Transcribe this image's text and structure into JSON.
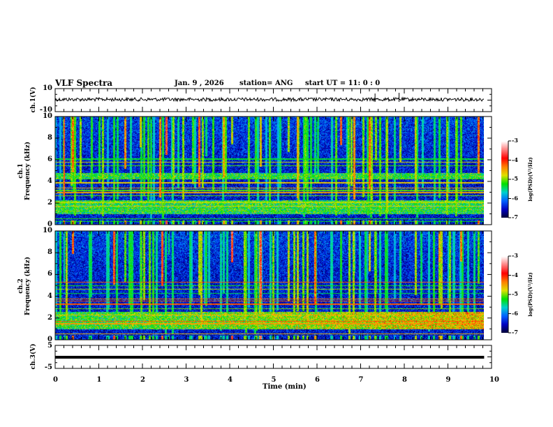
{
  "header": {
    "title": "VLF Spectra",
    "date": "Jan. 9 , 2026",
    "station": "station= ANG",
    "start": "start UT =   11: 0  : 0"
  },
  "chart_data": [
    {
      "type": "line",
      "panel": "ch1",
      "ylabel": "ch.1(V)",
      "ylim": [
        -10,
        10
      ],
      "yticks": [
        "10",
        "-10"
      ],
      "approx_level": 0
    },
    {
      "type": "heatmap",
      "panel": "ch1-spectrogram",
      "ylabel_top": "ch.1",
      "ylabel": "Frequency (kHz)",
      "ylim": [
        0,
        10
      ],
      "yticks": [
        "0",
        "2",
        "4",
        "6",
        "8",
        "10"
      ],
      "narrowband_lines_khz": [
        0.3,
        0.6,
        1.3,
        1.55,
        1.75,
        2.1,
        2.7,
        3.0,
        3.2,
        3.4,
        3.9,
        4.25,
        4.5,
        5.5,
        5.8,
        6.1
      ],
      "noise_bands_khz": [
        [
          1.0,
          2.3
        ],
        [
          4.2,
          4.8
        ]
      ],
      "impulsive_events_min": [
        0.2,
        0.4,
        1.35,
        1.6,
        1.95,
        2.4,
        2.55,
        3.3,
        3.45,
        3.85,
        4.05,
        4.7,
        5.35,
        5.55,
        5.95,
        6.55,
        6.85,
        7.2,
        7.35,
        7.9,
        8.25,
        8.8,
        9.3,
        9.7
      ],
      "data_end_min": 9.83
    },
    {
      "type": "heatmap",
      "panel": "ch2-spectrogram",
      "ylabel_top": "ch.2",
      "ylabel": "Frequency (kHz)",
      "ylim": [
        0,
        10
      ],
      "yticks": [
        "0",
        "2",
        "4",
        "6",
        "8",
        "10"
      ],
      "narrowband_lines_khz": [
        0.6,
        1.2,
        1.5,
        1.75,
        2.3,
        2.9,
        3.3,
        3.6,
        3.8,
        4.3,
        4.7,
        5.0,
        5.3
      ],
      "noise_bands_khz": [
        [
          1.0,
          2.6
        ]
      ],
      "impulsive_events_min": [
        0.2,
        0.4,
        1.35,
        1.6,
        1.95,
        2.45,
        2.6,
        3.3,
        3.45,
        3.85,
        4.05,
        4.7,
        5.35,
        5.55,
        5.95,
        6.55,
        6.85,
        7.2,
        7.35,
        7.9,
        8.25,
        8.8,
        9.3,
        9.7
      ],
      "data_end_min": 9.83
    },
    {
      "type": "line",
      "panel": "ch3",
      "ylabel": "ch.3(V)",
      "ylim": [
        -5,
        5
      ],
      "yticks": [
        "5",
        "-5"
      ],
      "approx_level": 0
    }
  ],
  "xaxis": {
    "label": "Time  (min)",
    "ticks": [
      "0",
      "1",
      "2",
      "3",
      "4",
      "5",
      "6",
      "7",
      "8",
      "9",
      "10"
    ],
    "xlim": [
      0,
      10
    ]
  },
  "colorbar": {
    "label": "log(PSD)(V²/Hz)",
    "ticks": [
      "-3",
      "-4",
      "-5",
      "-6",
      "-7"
    ],
    "range": [
      -7,
      -3
    ],
    "colors": [
      "#000030",
      "#0000c0",
      "#0060ff",
      "#00d0d0",
      "#00e000",
      "#e0e000",
      "#ff8000",
      "#ff0000",
      "#ff8080",
      "#ffffff"
    ]
  }
}
